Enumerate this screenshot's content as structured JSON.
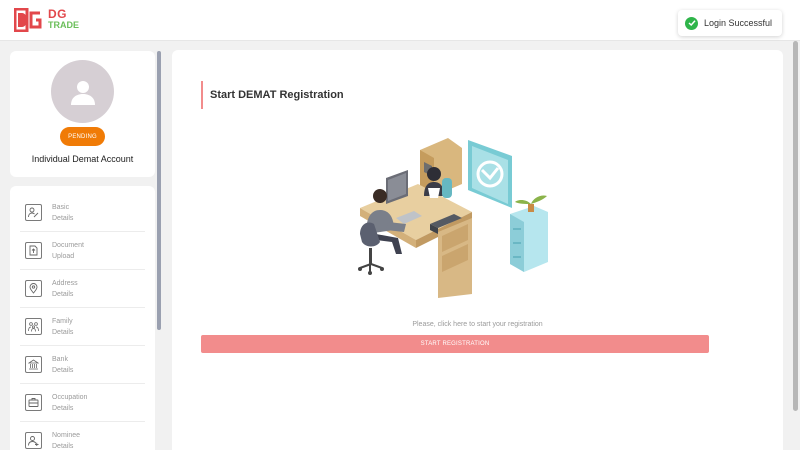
{
  "brand": {
    "line1": "DG",
    "line2": "TRADE",
    "mark": "DG"
  },
  "toast": {
    "message": "Login Successful",
    "icon": "check-circle-icon",
    "color": "#2fb54a"
  },
  "profile": {
    "status": "PENDING",
    "status_color": "#f07b06",
    "account_type": "Individual Demat Account",
    "icon": "user-icon"
  },
  "sidebar": {
    "items": [
      {
        "line1": "Basic",
        "line2": "Details",
        "icon": "person-edit-icon"
      },
      {
        "line1": "Document",
        "line2": "Upload",
        "icon": "document-upload-icon"
      },
      {
        "line1": "Address",
        "line2": "Details",
        "icon": "location-pin-icon"
      },
      {
        "line1": "Family",
        "line2": "Details",
        "icon": "family-icon"
      },
      {
        "line1": "Bank",
        "line2": "Details",
        "icon": "bank-icon"
      },
      {
        "line1": "Occupation",
        "line2": "Details",
        "icon": "briefcase-icon"
      },
      {
        "line1": "Nominee",
        "line2": "Details",
        "icon": "nominee-icon"
      }
    ]
  },
  "main": {
    "title": "Start DEMAT Registration",
    "hint": "Please, click here to start your registration",
    "button": "START REGISTRATION",
    "accent": "#f28c8c"
  }
}
